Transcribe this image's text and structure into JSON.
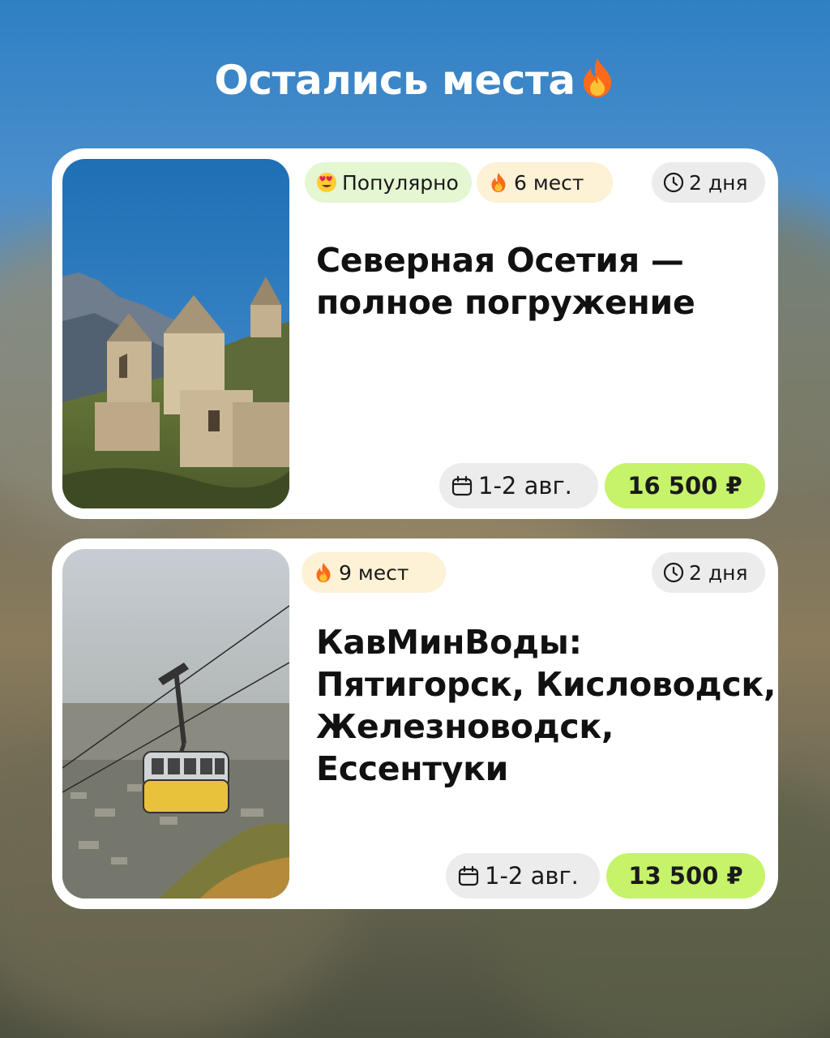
{
  "page": {
    "title": "Остались места",
    "title_icon": "fire-icon"
  },
  "tours": [
    {
      "badges": [
        "Популярно",
        "6 мест"
      ],
      "badge_icons": [
        "heart-eyes-emoji-icon",
        "fire-icon"
      ],
      "duration": "2 дня",
      "title_lines": [
        "Северная Осетия —",
        "полное погружение"
      ],
      "dates": "1-2 авг.",
      "price": "16 500 ₽",
      "photo": "dargavs-towers-photo"
    },
    {
      "badges": [
        "9 мест"
      ],
      "badge_icons": [
        "fire-icon"
      ],
      "duration": "2 дня",
      "title_lines": [
        "КавМинВоды:",
        "Пятигорск, Кисловодск,",
        "Железноводск,",
        "Ессентуки"
      ],
      "dates": "1-2 авг.",
      "price": "13 500 ₽",
      "photo": "cable-car-photo"
    }
  ],
  "colors": {
    "price_bg": "#c6f36a",
    "popular_bg": "#e4f6d2",
    "seats_bg": "#fdf1d6",
    "neutral_bg": "#ececec"
  }
}
